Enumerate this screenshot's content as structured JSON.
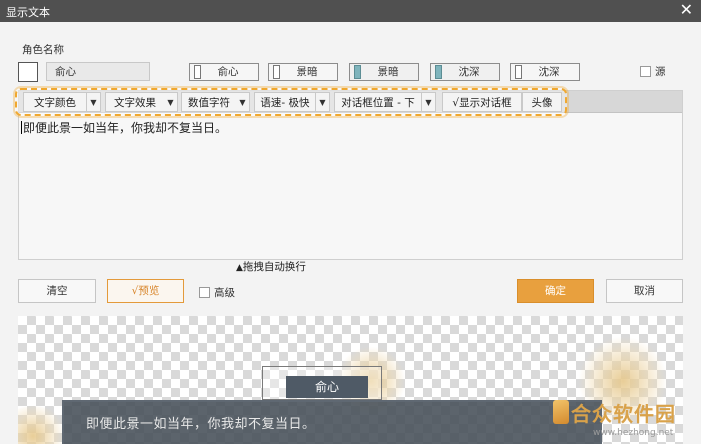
{
  "window": {
    "title": "显示文本",
    "close_glyph": "✕"
  },
  "role": {
    "label": "角色名称",
    "name_value": "俞心",
    "presets": [
      {
        "label": "俞心",
        "active": false
      },
      {
        "label": "景暗",
        "active": false
      },
      {
        "label": "景暗",
        "active": true
      },
      {
        "label": "沈深",
        "active": true
      },
      {
        "label": "沈深",
        "active": false
      }
    ],
    "source_label": "源"
  },
  "toolbar": {
    "items": [
      {
        "label": "文字颜色",
        "dropdown": true
      },
      {
        "label": "文字效果",
        "dropdown": true
      },
      {
        "label": "数值字符",
        "dropdown": true
      },
      {
        "label": "语速- 极快",
        "dropdown": true
      },
      {
        "label": "对话框位置 - 下",
        "dropdown": true
      },
      {
        "label": "√显示对话框",
        "dropdown": false
      },
      {
        "label": "头像",
        "dropdown": false
      }
    ],
    "highlight_color": "#f0a830"
  },
  "editor": {
    "text": "即便此景一如当年，你我却不复当日。"
  },
  "wrap_hint": {
    "arrow": "▲",
    "label": "拖拽自动换行"
  },
  "actions": {
    "clear": "清空",
    "preview": "√预览",
    "advanced": "高级",
    "ok": "确定",
    "cancel": "取消"
  },
  "preview": {
    "speaker": "俞心",
    "line": "即便此景一如当年，你我却不复当日。"
  },
  "watermark": {
    "name": "合众软件园",
    "url": "www.hezhong.net"
  },
  "colors": {
    "accent": "#e8a03e",
    "title_bar": "#505050",
    "active_preset": "#7fb4bc"
  }
}
